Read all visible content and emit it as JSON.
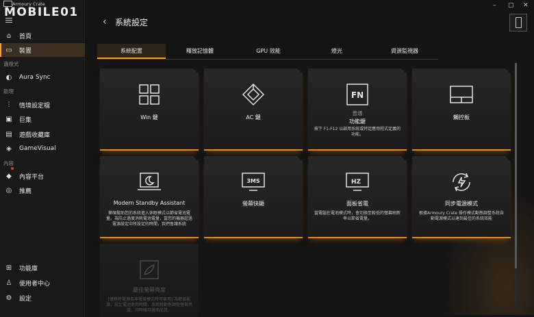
{
  "app": {
    "title": "Armoury Crate",
    "watermark": "MOBILE01"
  },
  "window_controls": {
    "minimize": "–",
    "maximize": "▢",
    "close": "✕"
  },
  "sidebar": {
    "items": [
      {
        "label": "首頁",
        "icon": "home-icon"
      },
      {
        "label": "裝置",
        "icon": "device-icon",
        "active": true
      },
      {
        "label": "Aura Sync",
        "icon": "aura-icon"
      },
      {
        "label": "情境設定檔",
        "icon": "sliders-icon"
      },
      {
        "label": "巨集",
        "icon": "macro-icon"
      },
      {
        "label": "遊戲收藏庫",
        "icon": "library-icon"
      },
      {
        "label": "GameVisual",
        "icon": "gamevisual-icon"
      },
      {
        "label": "內容平台",
        "icon": "content-icon"
      },
      {
        "label": "推薦",
        "icon": "recommend-icon"
      },
      {
        "label": "功能庫",
        "icon": "feature-library-icon"
      },
      {
        "label": "使用者中心",
        "icon": "user-center-icon"
      },
      {
        "label": "設定",
        "icon": "settings-icon"
      }
    ],
    "sections": {
      "lighting": "邊燈光",
      "assistant": "助理",
      "content": "內容"
    }
  },
  "header": {
    "back": "‹",
    "title": "系統設定"
  },
  "tabs": [
    {
      "label": "系統配置",
      "active": true
    },
    {
      "label": "釋放記憶體"
    },
    {
      "label": "GPU 效能"
    },
    {
      "label": "燈光"
    },
    {
      "label": "資源監視器"
    }
  ],
  "cards": [
    {
      "title": "Win 鍵",
      "icon": "windows-key-icon"
    },
    {
      "title": "AC 鍵",
      "icon": "ac-key-icon"
    },
    {
      "title": "功能鍵",
      "subtitle": "普通",
      "desc": "按下 F1-F12 以啟用系統或特定應用程式定義的功能。",
      "icon": "fn-key-icon"
    },
    {
      "title": "觸控板",
      "icon": "touchpad-icon"
    },
    {
      "title": "Modern Standby Assistant",
      "desc": "華碩幫助您的系統進入休眠模式以節省電池電量。為防止過度消耗電池電量，當您的機器超過電源設定中所設定的時間，我們會讓系統",
      "icon": "standby-icon"
    },
    {
      "title": "螢幕快顯",
      "icon": "overdrive-icon",
      "icon_text": "3MS"
    },
    {
      "title": "面板省電",
      "desc": "當電腦在電池模式時，會切換至較低的螢幕刷新率以節省電量。",
      "icon": "panel-power-saver-icon",
      "icon_text": "HZ"
    },
    {
      "title": "同步電源模式",
      "desc": "根據Armoury Crate 操作模式動態調整系統自動電源模式以達到最佳的系統效能",
      "icon": "sync-power-icon"
    },
    {
      "title": "最佳螢幕亮度",
      "desc": "[僅移除電源且非電競模式時可套用] 為節省能源，設定電池使用時間，系統將動態調整螢幕亮度，同時維持畫面品質。",
      "icon": "brightness-icon",
      "disabled": true
    }
  ],
  "colors": {
    "accent": "#ff9d1a",
    "background": "#141414",
    "card": "#242424"
  }
}
